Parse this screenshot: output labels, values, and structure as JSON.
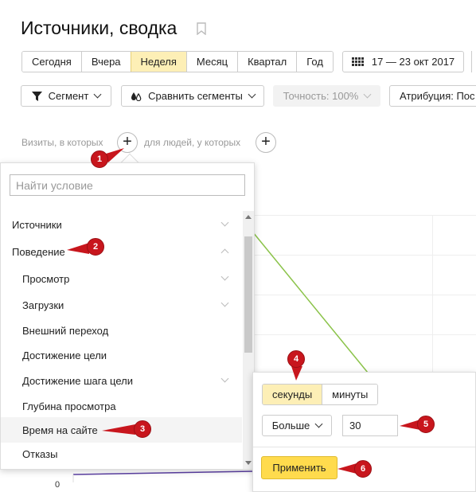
{
  "page": {
    "title": "Источники, сводка"
  },
  "period": {
    "buttons": [
      "Сегодня",
      "Вчера",
      "Неделя",
      "Месяц",
      "Квартал",
      "Год"
    ],
    "active": "Неделя",
    "date_range": "17 — 23 окт 2017"
  },
  "toolbar": {
    "segment_label": "Сегмент",
    "compare_label": "Сравнить сегменты",
    "accuracy_label": "Точность: 100%",
    "attribution_label": "Атрибуция: Пос"
  },
  "filter": {
    "visits_label": "Визиты, в которых",
    "people_label": "для людей, у которых"
  },
  "dropdown": {
    "search_placeholder": "Найти условие",
    "items": [
      {
        "label": "Источники"
      },
      {
        "label": "Поведение"
      },
      {
        "label": "Просмотр"
      },
      {
        "label": "Загрузки"
      },
      {
        "label": "Внешний переход"
      },
      {
        "label": "Достижение цели"
      },
      {
        "label": "Достижение шага цели"
      },
      {
        "label": "Глубина просмотра"
      },
      {
        "label": "Время на сайте"
      },
      {
        "label": "Отказы"
      }
    ]
  },
  "popover": {
    "unit_seconds": "секунды",
    "unit_minutes": "минуты",
    "comparator": "Больше",
    "value": "30",
    "apply_label": "Применить"
  },
  "chart": {
    "zero_label": "0"
  },
  "markers": [
    "1",
    "2",
    "3",
    "4",
    "5",
    "6"
  ],
  "colors": {
    "marker": "#c8161d",
    "active_tab": "#fdefb6",
    "apply": "#ffdb4d",
    "line": "#8bc34a"
  }
}
